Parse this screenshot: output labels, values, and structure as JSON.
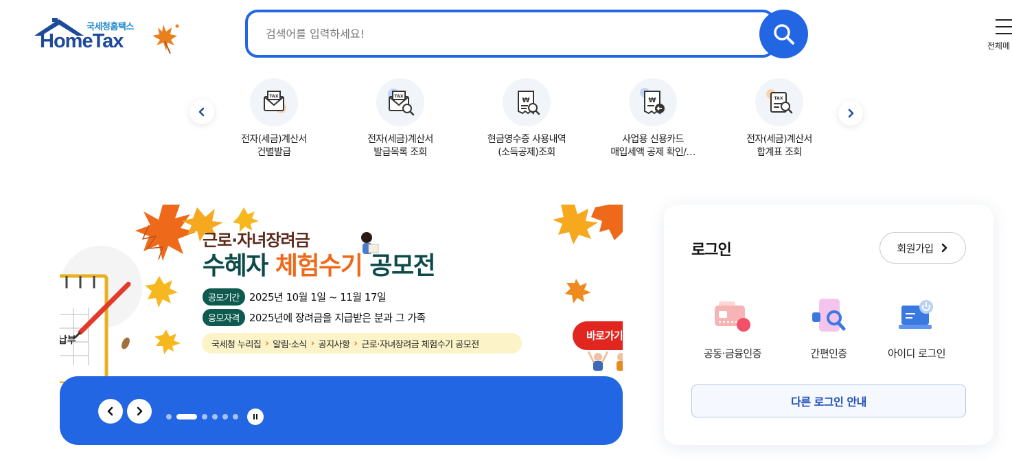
{
  "header": {
    "logo_sub": "국세청홈택스",
    "logo_main": "HomeTax",
    "search_placeholder": "검색어를 입력하세요!",
    "all_menu_label": "전체메"
  },
  "quick_menu": {
    "items": [
      {
        "line1": "전자(세금)계산서",
        "line2": "건별발급",
        "icon": "tax-envelope-icon"
      },
      {
        "line1": "전자(세금)계산서",
        "line2": "발급목록 조회",
        "icon": "tax-envelope-search-icon"
      },
      {
        "line1": "현금영수증 사용내역",
        "line2": "(소득공제)조회",
        "icon": "receipt-search-icon"
      },
      {
        "line1": "사업용 신용카드",
        "line2": "매입세액 공제 확인/…",
        "icon": "receipt-card-icon"
      },
      {
        "line1": "전자(세금)계산서",
        "line2": "합계표 조회",
        "icon": "tax-document-search-icon"
      }
    ]
  },
  "banner": {
    "title_line1": "근로·자녀장려금",
    "title_part1": "수혜자 ",
    "title_highlight": "체험수기",
    "title_part2": " 공모전",
    "period_tag": "공모기간",
    "period_text": "2025년 10월 1일 ~ 11월 17일",
    "eligibility_tag": "응모자격",
    "eligibility_text": "2025년에 장려금을 지급받은 분과 그 가족",
    "path": [
      "국세청 누리집",
      "알림·소식",
      "공지사항",
      "근로·자녀장려금 체험수기 공모전"
    ],
    "go_button": "바로가기",
    "calendar_text": "납부",
    "slide_count": 6,
    "active_slide": 2
  },
  "login": {
    "title": "로그인",
    "join_button": "회원가입",
    "options": [
      {
        "label": "공동·금융인증",
        "icon": "certificate-card-icon"
      },
      {
        "label": "간편인증",
        "icon": "phone-search-icon"
      },
      {
        "label": "아이디 로그인",
        "icon": "laptop-power-icon"
      }
    ],
    "other_button": "다른 로그인 안내"
  },
  "colors": {
    "primary_blue": "#2266e3",
    "logo_navy": "#1e4a9a",
    "banner_orange": "#ee6a1a",
    "banner_green": "#0e5a4e",
    "go_red": "#e0261e"
  }
}
